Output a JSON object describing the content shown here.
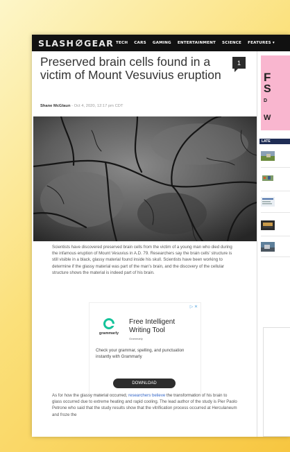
{
  "site": {
    "logo_left": "SLASH",
    "logo_right": "GEAR"
  },
  "nav": {
    "items": [
      "TECH",
      "CARS",
      "GAMING",
      "ENTERTAINMENT",
      "SCIENCE",
      "FEATURES ▾"
    ]
  },
  "article": {
    "headline": "Preserved brain cells found in a victim of Mount Vesuvius eruption",
    "comment_count": "1",
    "author": "Shane McGlaun",
    "date": " - Oct 4, 2020, 12:17 pm CDT",
    "paragraph1": "Scientists have discovered preserved brain cells from the victim of a young man who died during the infamous eruption of Mount Vesuvius in A.D. 79. Researchers say the brain cells' structure is still visible in a black, glassy material found inside his skull. Scientists have been working to determine if the glassy material was part of the man's brain, and the discovery of the cellular structure shows the material is indeed part of his brain.",
    "paragraph2_before": "As for how the glassy material occurred, ",
    "paragraph2_link": "researchers believe",
    "paragraph2_after": " the transformation of his brain to glass occurred due to extreme heating and rapid cooling. The lead author of the study is Pier Paolo Petrone who said that the study results show that the vitrification process occurred at Herculaneum and froze the"
  },
  "ad": {
    "adchoices": "▷ ✕",
    "brand": "grammarly",
    "title": "Free Intelligent Writing Tool",
    "sub": "Grammarly",
    "body": "Check your grammar, spelling, and punctuation instantly with Grammarly",
    "button": "DOWNLOAD"
  },
  "sidebar": {
    "ad_letters": [
      "F",
      "S",
      "D",
      "W"
    ],
    "latest_label": "LATE",
    "frame_letter": "L"
  },
  "colors": {
    "accent_link": "#3d6fd0",
    "grammarly_green": "#15c39a",
    "latest_bg": "#1f2d55",
    "sidebar_ad_bg": "#f9b6cf"
  }
}
